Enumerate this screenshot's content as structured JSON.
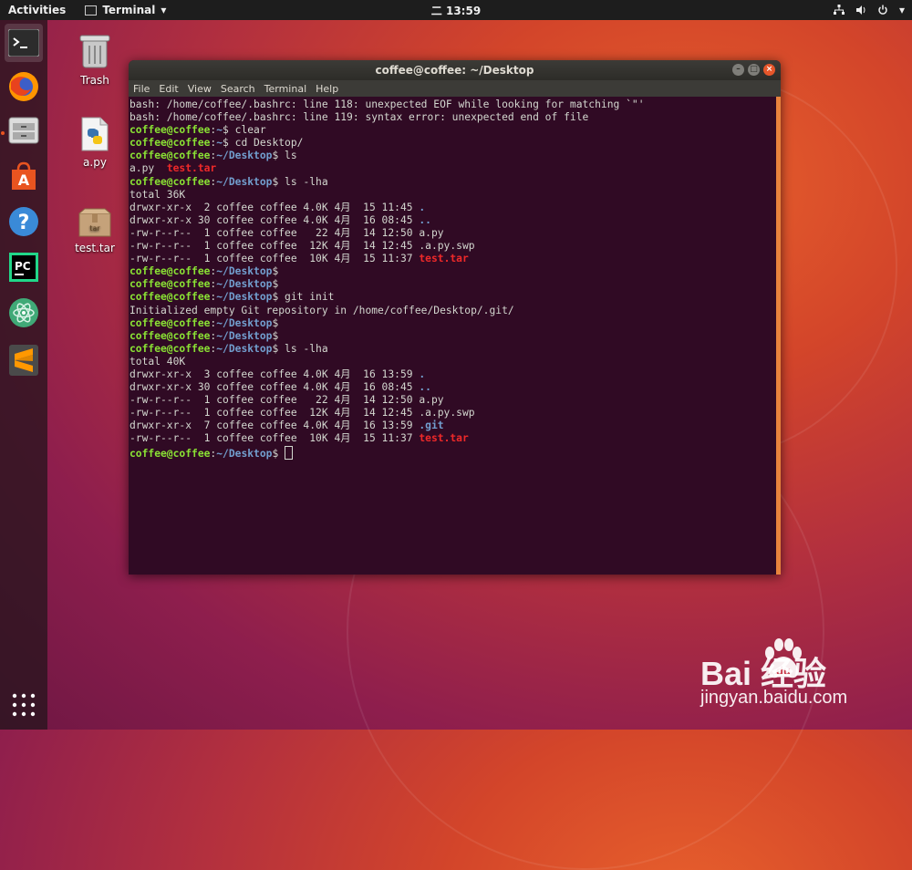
{
  "topbar": {
    "activities": "Activities",
    "app_menu": "Terminal",
    "clock": "二 13:59"
  },
  "dock": {
    "items": [
      {
        "icon": "terminal-icon"
      },
      {
        "icon": "firefox-icon"
      },
      {
        "icon": "files-icon"
      },
      {
        "icon": "software-icon"
      },
      {
        "icon": "help-icon"
      },
      {
        "icon": "pycharm-icon"
      },
      {
        "icon": "atom-icon"
      },
      {
        "icon": "sublime-icon"
      }
    ],
    "apps_grid_icon": "apps-grid-icon"
  },
  "desktop": {
    "icons": [
      {
        "label": "Trash",
        "icon": "trash-icon"
      },
      {
        "label": "a.py",
        "icon": "python-file-icon"
      },
      {
        "label": "test.tar",
        "icon": "archive-icon"
      }
    ]
  },
  "window": {
    "title": "coffee@coffee: ~/Desktop",
    "menu": [
      "File",
      "Edit",
      "View",
      "Search",
      "Terminal",
      "Help"
    ]
  },
  "terminal": {
    "lines": [
      [
        {
          "t": "bash: /home/coffee/.bashrc: line 118: unexpected EOF while looking for matching `\"'"
        }
      ],
      [
        {
          "t": "bash: /home/coffee/.bashrc: line 119: syntax error: unexpected end of file"
        }
      ],
      [
        {
          "t": "coffee@coffee",
          "c": "user"
        },
        {
          "t": ":"
        },
        {
          "t": "~",
          "c": "path"
        },
        {
          "t": "$ clear"
        }
      ],
      [
        {
          "t": "coffee@coffee",
          "c": "user"
        },
        {
          "t": ":"
        },
        {
          "t": "~",
          "c": "path"
        },
        {
          "t": "$ cd Desktop/"
        }
      ],
      [
        {
          "t": "coffee@coffee",
          "c": "user"
        },
        {
          "t": ":"
        },
        {
          "t": "~/Desktop",
          "c": "path"
        },
        {
          "t": "$ ls"
        }
      ],
      [
        {
          "t": "a.py  "
        },
        {
          "t": "test.tar",
          "c": "red"
        }
      ],
      [
        {
          "t": "coffee@coffee",
          "c": "user"
        },
        {
          "t": ":"
        },
        {
          "t": "~/Desktop",
          "c": "path"
        },
        {
          "t": "$ ls -lha"
        }
      ],
      [
        {
          "t": "total 36K"
        }
      ],
      [
        {
          "t": "drwxr-xr-x  2 coffee coffee 4.0K 4月  15 11:45 "
        },
        {
          "t": ".",
          "c": "blue"
        }
      ],
      [
        {
          "t": "drwxr-xr-x 30 coffee coffee 4.0K 4月  16 08:45 "
        },
        {
          "t": "..",
          "c": "blue"
        }
      ],
      [
        {
          "t": "-rw-r--r--  1 coffee coffee   22 4月  14 12:50 a.py"
        }
      ],
      [
        {
          "t": "-rw-r--r--  1 coffee coffee  12K 4月  14 12:45 .a.py.swp"
        }
      ],
      [
        {
          "t": "-rw-r--r--  1 coffee coffee  10K 4月  15 11:37 "
        },
        {
          "t": "test.tar",
          "c": "red"
        }
      ],
      [
        {
          "t": "coffee@coffee",
          "c": "user"
        },
        {
          "t": ":"
        },
        {
          "t": "~/Desktop",
          "c": "path"
        },
        {
          "t": "$"
        }
      ],
      [
        {
          "t": "coffee@coffee",
          "c": "user"
        },
        {
          "t": ":"
        },
        {
          "t": "~/Desktop",
          "c": "path"
        },
        {
          "t": "$"
        }
      ],
      [
        {
          "t": "coffee@coffee",
          "c": "user"
        },
        {
          "t": ":"
        },
        {
          "t": "~/Desktop",
          "c": "path"
        },
        {
          "t": "$ git init"
        }
      ],
      [
        {
          "t": "Initialized empty Git repository in /home/coffee/Desktop/.git/"
        }
      ],
      [
        {
          "t": "coffee@coffee",
          "c": "user"
        },
        {
          "t": ":"
        },
        {
          "t": "~/Desktop",
          "c": "path"
        },
        {
          "t": "$"
        }
      ],
      [
        {
          "t": "coffee@coffee",
          "c": "user"
        },
        {
          "t": ":"
        },
        {
          "t": "~/Desktop",
          "c": "path"
        },
        {
          "t": "$"
        }
      ],
      [
        {
          "t": "coffee@coffee",
          "c": "user"
        },
        {
          "t": ":"
        },
        {
          "t": "~/Desktop",
          "c": "path"
        },
        {
          "t": "$ ls -lha"
        }
      ],
      [
        {
          "t": "total 40K"
        }
      ],
      [
        {
          "t": "drwxr-xr-x  3 coffee coffee 4.0K 4月  16 13:59 "
        },
        {
          "t": ".",
          "c": "blue"
        }
      ],
      [
        {
          "t": "drwxr-xr-x 30 coffee coffee 4.0K 4月  16 08:45 "
        },
        {
          "t": "..",
          "c": "blue"
        }
      ],
      [
        {
          "t": "-rw-r--r--  1 coffee coffee   22 4月  14 12:50 a.py"
        }
      ],
      [
        {
          "t": "-rw-r--r--  1 coffee coffee  12K 4月  14 12:45 .a.py.swp"
        }
      ],
      [
        {
          "t": "drwxr-xr-x  7 coffee coffee 4.0K 4月  16 13:59 "
        },
        {
          "t": ".git",
          "c": "blue"
        }
      ],
      [
        {
          "t": "-rw-r--r--  1 coffee coffee  10K 4月  15 11:37 "
        },
        {
          "t": "test.tar",
          "c": "red"
        }
      ],
      [
        {
          "t": "coffee@coffee",
          "c": "user"
        },
        {
          "t": ":"
        },
        {
          "t": "~/Desktop",
          "c": "path"
        },
        {
          "t": "$ "
        },
        {
          "cursor": true
        }
      ]
    ]
  },
  "watermark": {
    "brand": "Bai  经验",
    "url": "jingyan.baidu.com"
  },
  "colors": {
    "prompt_user": "#8ae234",
    "prompt_path": "#729fcf",
    "archive": "#ef2929",
    "terminal_bg": "#300a24"
  }
}
